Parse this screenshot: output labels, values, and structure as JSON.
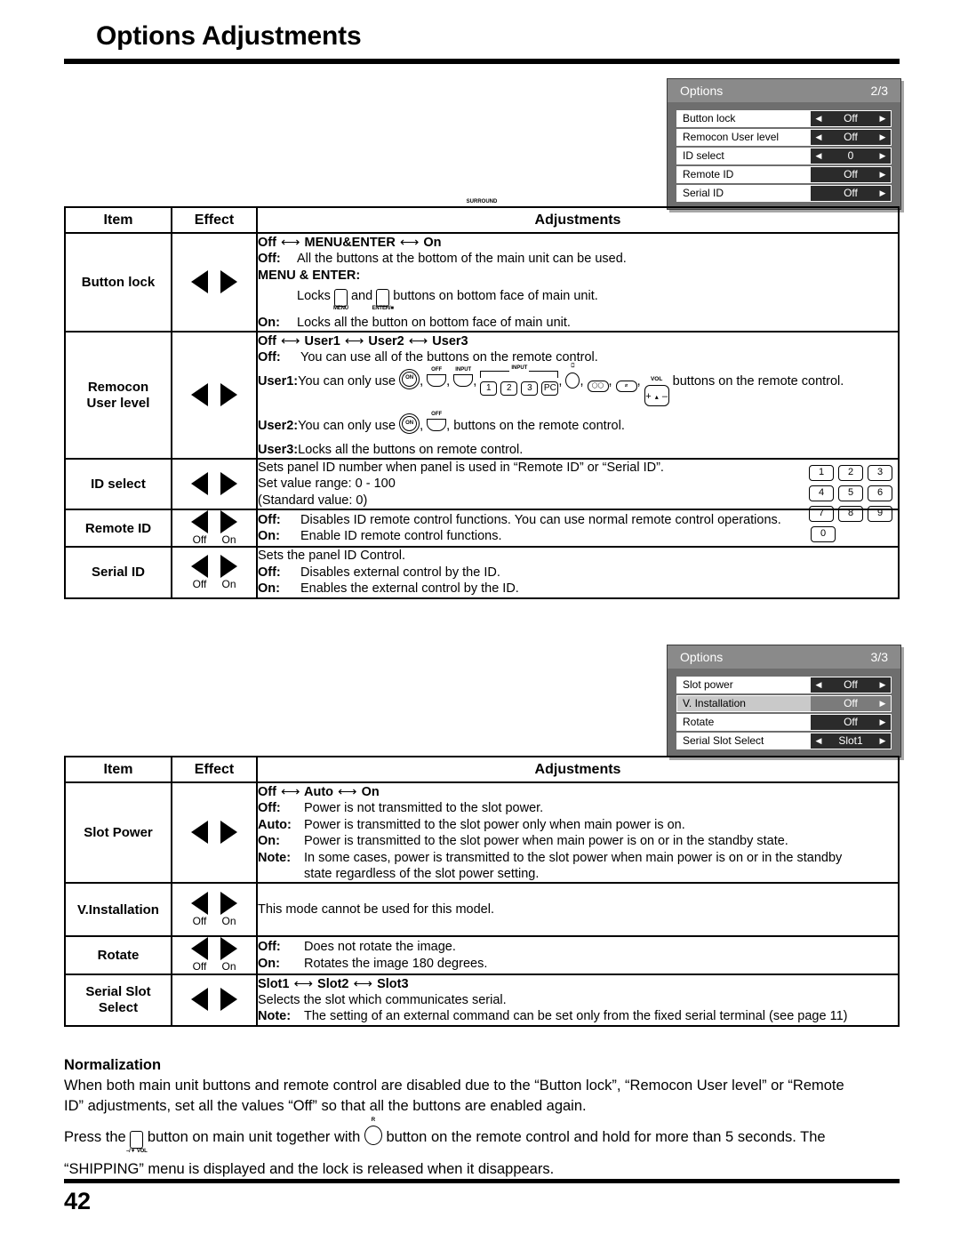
{
  "header": {
    "title": "Options Adjustments"
  },
  "osd_panels": [
    {
      "title": "Options",
      "page_indicator": "2/3",
      "rows": [
        {
          "label": "Button lock",
          "value": "Off",
          "left_arrow": "◀",
          "right_arrow": "▶",
          "has_left_arrow": true,
          "highlighted": false
        },
        {
          "label": "Remocon User level",
          "value": "Off",
          "left_arrow": "◀",
          "right_arrow": "▶",
          "has_left_arrow": true,
          "highlighted": false
        },
        {
          "label": "ID select",
          "value": "0",
          "left_arrow": "◀",
          "right_arrow": "▶",
          "has_left_arrow": true,
          "highlighted": false
        },
        {
          "label": "Remote ID",
          "value": "Off",
          "left_arrow": "◀",
          "right_arrow": "▶",
          "has_left_arrow": false,
          "highlighted": false
        },
        {
          "label": "Serial ID",
          "value": "Off",
          "left_arrow": "◀",
          "right_arrow": "▶",
          "has_left_arrow": false,
          "highlighted": false
        }
      ]
    },
    {
      "title": "Options",
      "page_indicator": "3/3",
      "rows": [
        {
          "label": "Slot power",
          "value": "Off",
          "left_arrow": "◀",
          "right_arrow": "▶",
          "has_left_arrow": true,
          "highlighted": false
        },
        {
          "label": "V. Installation",
          "value": "Off",
          "left_arrow": "◀",
          "right_arrow": "▶",
          "has_left_arrow": false,
          "highlighted": true
        },
        {
          "label": "Rotate",
          "value": "Off",
          "left_arrow": "◀",
          "right_arrow": "▶",
          "has_left_arrow": false,
          "highlighted": false
        },
        {
          "label": "Serial Slot Select",
          "value": "Slot1",
          "left_arrow": "◀",
          "right_arrow": "▶",
          "has_left_arrow": true,
          "highlighted": false
        }
      ]
    }
  ],
  "table1": {
    "headers": {
      "item": "Item",
      "effect": "Effect",
      "adjustments": "Adjustments"
    },
    "rows": {
      "button_lock": {
        "item": "Button lock",
        "effect_caption_left": "",
        "effect_caption_right": "",
        "chain": {
          "a": "Off",
          "b": "MENU&ENTER",
          "c": "On"
        },
        "off_label": "Off:",
        "off_text": "All the buttons at the bottom of the main unit can be used.",
        "menu_enter_label": "MENU & ENTER:",
        "locks_prefix": "Locks",
        "locks_and": "and",
        "locks_suffix": "buttons on bottom face of main unit.",
        "glyph1_caption": "MENU",
        "glyph2_caption": "ENTER/■",
        "on_label": "On:",
        "on_text": "Locks all the button on bottom face of main unit."
      },
      "remocon_user_level": {
        "item_line1": "Remocon",
        "item_line2": "User level",
        "effect_caption_left": "",
        "effect_caption_right": "",
        "chain": {
          "a": "Off",
          "b": "User1",
          "c": "User2",
          "d": "User3"
        },
        "off_label": "Off:",
        "off_text": "You can use all of the buttons on the remote control.",
        "user1_label": "User1:",
        "user1_prefix": "You can only use",
        "user1_suffix": "buttons on the remote control.",
        "user2_label": "User2:",
        "user2_prefix": "You can only use",
        "user2_suffix": ", buttons on the remote control.",
        "user3_label": "User3:",
        "user3_text": "Locks all the buttons on remote control.",
        "remote_glyphs": {
          "on": "ON",
          "off": "OFF",
          "input": "INPUT",
          "input_bracket": "INPUT",
          "num1": "1",
          "num2": "2",
          "num3": "3",
          "pc": "PC",
          "aspect_cap": "⎕",
          "surround_cap": "SURROUND",
          "surround": "◯◯",
          "mute": "⌀",
          "vol_cap": "VOL",
          "vol_plus": "+",
          "vol_mid": "▴",
          "vol_minus": "–"
        }
      },
      "id_select": {
        "item": "ID select",
        "effect_caption_left": "",
        "effect_caption_right": "",
        "line1": "Sets panel ID number when panel is used in “Remote ID” or “Serial ID”.",
        "line2": "Set value range: 0 - 100",
        "line3": "(Standard value: 0)",
        "keypad": [
          [
            "1",
            "2",
            "3"
          ],
          [
            "4",
            "5",
            "6"
          ],
          [
            "7",
            "8",
            "9"
          ],
          [
            "0"
          ]
        ]
      },
      "remote_id": {
        "item": "Remote ID",
        "effect_caption_left": "Off",
        "effect_caption_right": "On",
        "off_label": "Off:",
        "off_text": "Disables ID remote control functions. You can use normal remote control operations.",
        "on_label": "On:",
        "on_text": "Enable ID remote control functions."
      },
      "serial_id": {
        "item": "Serial ID",
        "effect_caption_left": "Off",
        "effect_caption_right": "On",
        "line1": "Sets the panel ID Control.",
        "off_label": "Off:",
        "off_text": "Disables external control by the ID.",
        "on_label": "On:",
        "on_text": "Enables the external control by the ID."
      }
    }
  },
  "table2": {
    "headers": {
      "item": "Item",
      "effect": "Effect",
      "adjustments": "Adjustments"
    },
    "rows": {
      "slot_power": {
        "item": "Slot Power",
        "effect_caption_left": "",
        "effect_caption_right": "",
        "chain": {
          "a": "Off",
          "b": "Auto",
          "c": "On"
        },
        "off_label": "Off:",
        "off_text": "Power is not transmitted to the slot power.",
        "auto_label": "Auto:",
        "auto_text": "Power is transmitted to the slot power only when main power is on.",
        "on_label": "On:",
        "on_text": "Power is transmitted to the slot power when main power is on or in the standby state.",
        "note_label": "Note:",
        "note_text": "In some cases, power is transmitted to the slot power when main power is on or in the standby",
        "note_text2": "state regardless of the slot power setting."
      },
      "v_installation": {
        "item": "V.Installation",
        "effect_caption_left": "Off",
        "effect_caption_right": "On",
        "text": "This mode cannot be used for this model."
      },
      "rotate": {
        "item": "Rotate",
        "effect_caption_left": "Off",
        "effect_caption_right": "On",
        "off_label": "Off:",
        "off_text": "Does not rotate the image.",
        "on_label": "On:",
        "on_text": "Rotates the image 180 degrees."
      },
      "serial_slot_select": {
        "item_line1": "Serial Slot",
        "item_line2": "Select",
        "effect_caption_left": "",
        "effect_caption_right": "",
        "chain": {
          "a": "Slot1",
          "b": "Slot2",
          "c": "Slot3"
        },
        "line1": "Selects the slot which communicates serial.",
        "note_label": "Note:",
        "note_text": "The setting of an external command can be set only from the fixed serial terminal (see page 11)"
      }
    }
  },
  "normalization": {
    "heading": "Normalization",
    "para1_a": "When both main unit buttons and remote control are disabled due to the “Button lock”, “Remocon User level” or “Remote",
    "para1_b": "ID” adjustments, set all the values “Off” so that all the buttons are enabled again.",
    "para2_a": "Press the",
    "para2_b": "button on main unit together with",
    "para2_c": "button on the remote control and hold for more than 5 seconds. The",
    "para3": "“SHIPPING” menu is displayed and the lock is released when it disappears.",
    "glyph_vol_caption": "–/▼ VOL",
    "glyph_r_caption": "R"
  },
  "footer": {
    "page_number": "42"
  }
}
